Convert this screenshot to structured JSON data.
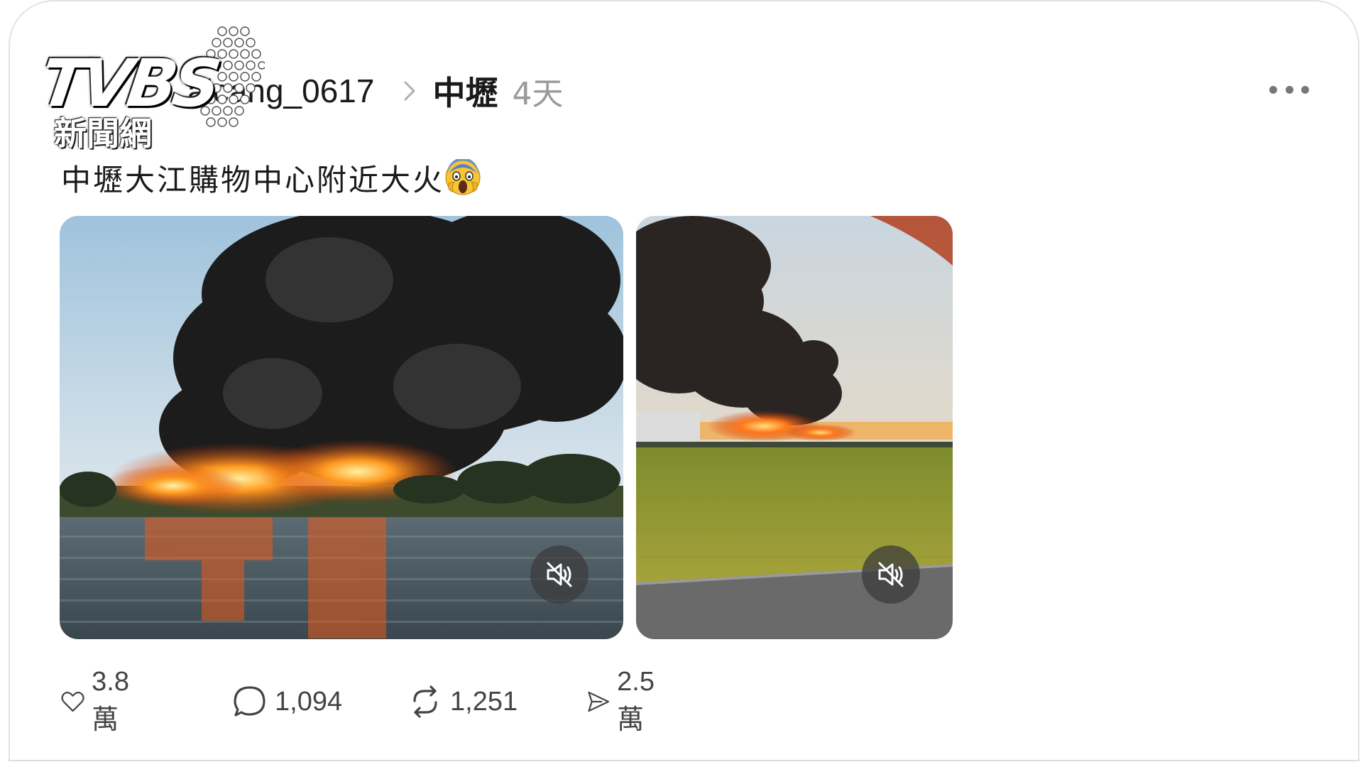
{
  "watermark": {
    "logo": "TVBS",
    "sub": "新聞網"
  },
  "post": {
    "username": "aicang_0617",
    "location": "中壢",
    "time": "4天",
    "text": "中壢大江購物中心附近大火",
    "emoji": "face-screaming-in-fear"
  },
  "media": [
    {
      "kind": "video",
      "muted": true,
      "mute_icon": "speaker-muted-icon"
    },
    {
      "kind": "video",
      "muted": true,
      "mute_icon": "speaker-muted-icon"
    }
  ],
  "actions": {
    "likes": "3.8 萬",
    "replies": "1,094",
    "reposts": "1,251",
    "shares": "2.5 萬"
  },
  "colors": {
    "text": "#1a1a1a",
    "muted": "#9a9a9a",
    "icon": "#444444",
    "border": "#e3e3e3"
  }
}
